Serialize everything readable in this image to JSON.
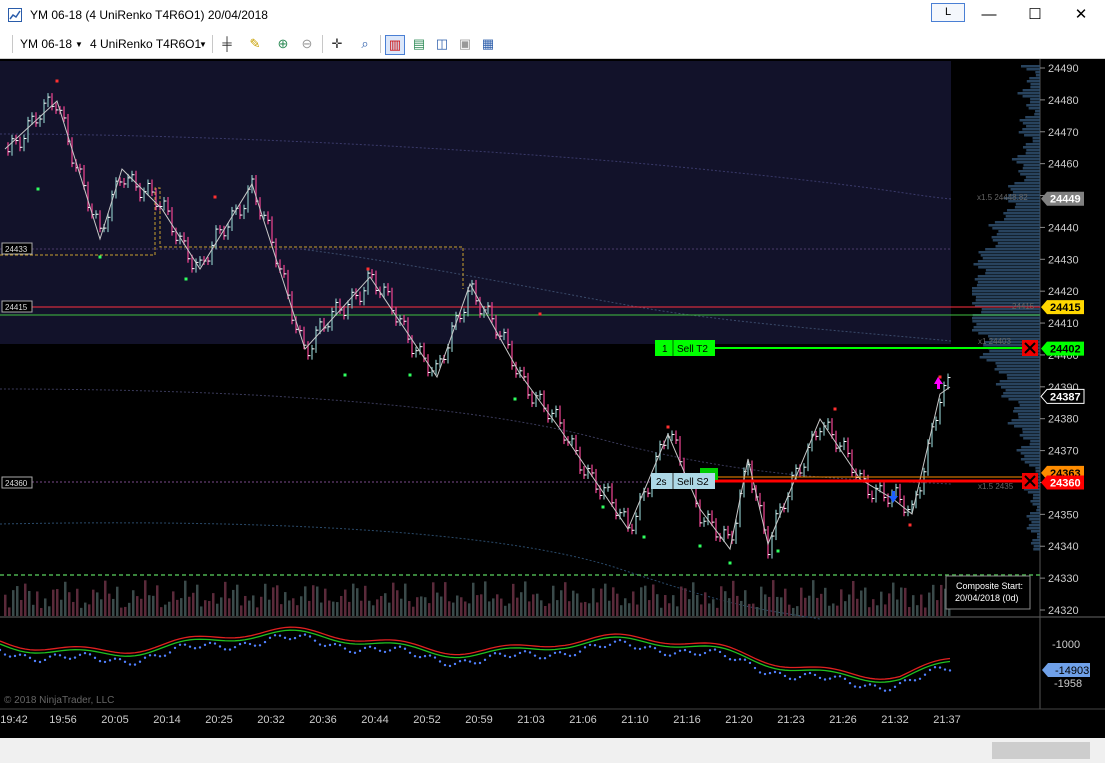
{
  "window": {
    "title": "YM 06-18 (4 UniRenko T4R6O1)  20/04/2018",
    "link_button": "L",
    "minimize": "—",
    "maximize": "☐",
    "close": "✕"
  },
  "toolbar": {
    "instrument": "YM 06-18",
    "interval": "4 UniRenko T4R6O1",
    "icons": [
      "bar-type-icon",
      "drawing-tool-icon",
      "zoom-in-icon",
      "zoom-out-icon",
      "crosshair-icon",
      "search-icon",
      "chart-trader-icon",
      "indicators-icon",
      "strategies-icon",
      "templates-icon",
      "properties-icon"
    ]
  },
  "price_axis": {
    "ticks": [
      "24490",
      "24480",
      "24470",
      "24460",
      "24450",
      "24440",
      "24430",
      "24420",
      "24410",
      "24400",
      "24390",
      "24380",
      "24370",
      "24360",
      "24350",
      "24340",
      "24330",
      "24320"
    ],
    "markers": [
      {
        "label": "24449",
        "color": "#808080"
      },
      {
        "label": "24415",
        "color": "#ffd700"
      },
      {
        "label": "24402",
        "color": "#00ff00"
      },
      {
        "label": "24387",
        "color": "#000000"
      },
      {
        "label": "24363",
        "color": "#ff8c00"
      },
      {
        "label": "24360",
        "color": "#ff0000"
      }
    ]
  },
  "left_levels": [
    "24433",
    "24415",
    "24360"
  ],
  "orders": {
    "target": {
      "qty": "1",
      "label": "Sell T2",
      "price": "24402"
    },
    "stop": {
      "qty": "2s",
      "label": "Sell S2",
      "price": "24360"
    }
  },
  "annotations": {
    "composite_title": "Composite Start:",
    "composite_date": "20/04/2018 (0d)",
    "copyright": "© 2018 NinjaTrader, LLC",
    "profile_labels": [
      "x1.5  24448.82",
      "24415",
      "x1  24403",
      "x1.5  2435"
    ]
  },
  "indicator_axis": {
    "ticks": [
      "-1000",
      "-1958"
    ],
    "marker": "-14903"
  },
  "time_axis": [
    "19:42",
    "19:56",
    "20:05",
    "20:14",
    "20:25",
    "20:32",
    "20:36",
    "20:44",
    "20:52",
    "20:59",
    "21:03",
    "21:06",
    "21:10",
    "21:16",
    "21:20",
    "21:23",
    "21:26",
    "21:32",
    "21:37"
  ],
  "colors": {
    "up": "#7fb3b3",
    "down": "#e0408a",
    "bull": "#1e90ff",
    "bear": "#ff1493",
    "zigzag": "#c8c8c8",
    "accent": "#4a7fd4"
  }
}
